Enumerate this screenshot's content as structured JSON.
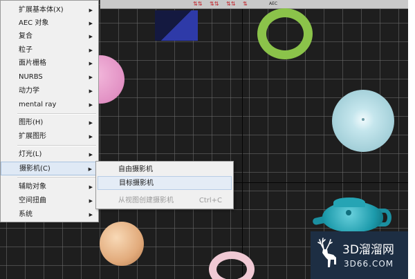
{
  "toolbar": {
    "text": "AEC",
    "icons": [
      "axis-constraint-icon",
      "axis-constraint-icon",
      "axis-constraint-icon",
      "axis-constraint-icon",
      "axis-constraint-icon"
    ]
  },
  "create_menu": {
    "items": [
      {
        "label": "扩展基本体(X)",
        "has_submenu": true
      },
      {
        "label": "AEC 对象",
        "has_submenu": true
      },
      {
        "label": "复合",
        "has_submenu": true
      },
      {
        "label": "粒子",
        "has_submenu": true
      },
      {
        "label": "面片栅格",
        "has_submenu": true
      },
      {
        "label": "NURBS",
        "has_submenu": true
      },
      {
        "label": "动力学",
        "has_submenu": true
      },
      {
        "label": "mental ray",
        "has_submenu": true
      },
      {
        "label": "图形(H)",
        "has_submenu": true
      },
      {
        "label": "扩展图形",
        "has_submenu": true
      },
      {
        "label": "灯光(L)",
        "has_submenu": true
      },
      {
        "label": "摄影机(C)",
        "has_submenu": true,
        "state": "highlighted"
      },
      {
        "label": "辅助对象",
        "has_submenu": true
      },
      {
        "label": "空间扭曲",
        "has_submenu": true
      },
      {
        "label": "系统",
        "has_submenu": true
      }
    ],
    "arrow_glyph": "▶"
  },
  "camera_submenu": {
    "items": [
      {
        "label": "自由摄影机",
        "shortcut": "",
        "state": "normal"
      },
      {
        "label": "目标摄影机",
        "shortcut": "",
        "state": "highlighted"
      },
      {
        "label": "从视图创建摄影机",
        "shortcut": "Ctrl+C",
        "state": "disabled"
      }
    ]
  },
  "viewport_objects": [
    "blue-box",
    "green-torus",
    "pink-sphere",
    "cone",
    "orange-sphere",
    "teapot",
    "pink-torus"
  ],
  "watermark": {
    "title": "3D溜溜网",
    "url": "3D66.COM"
  },
  "colors": {
    "viewport_bg": "#1e1e1e",
    "menu_bg": "#f0f0f0",
    "highlight": "#dfe9f5",
    "watermark_bg": "#1d2e43"
  }
}
